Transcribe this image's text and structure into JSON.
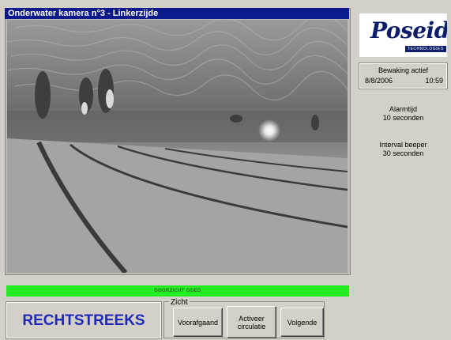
{
  "camera": {
    "title": "Onderwater kamera n°3 - Linkerzijde",
    "status_text": "DOORZICHT GOED"
  },
  "mode": {
    "label": "RECHTSTREEKS"
  },
  "view_group": {
    "legend": "Zicht",
    "prev_label": "Voorafgaand",
    "circulation_line1": "Activeer",
    "circulation_line2": "circulatie",
    "next_label": "Volgende"
  },
  "brand": {
    "name": "Poseidon",
    "tagline": "TECHNOLOGIES"
  },
  "monitoring": {
    "title": "Bewaking actief",
    "date": "8/8/2006",
    "time": "10:59"
  },
  "alarm": {
    "label": "Alarmtijd",
    "value": "10 seconden"
  },
  "beeper": {
    "label": "Interval beeper",
    "value": "30 seconden"
  },
  "colors": {
    "title_bar": "#0a1a8c",
    "status_ok": "#22ee22",
    "mode_text": "#1f2ab8",
    "brand": "#0b1d6b"
  }
}
